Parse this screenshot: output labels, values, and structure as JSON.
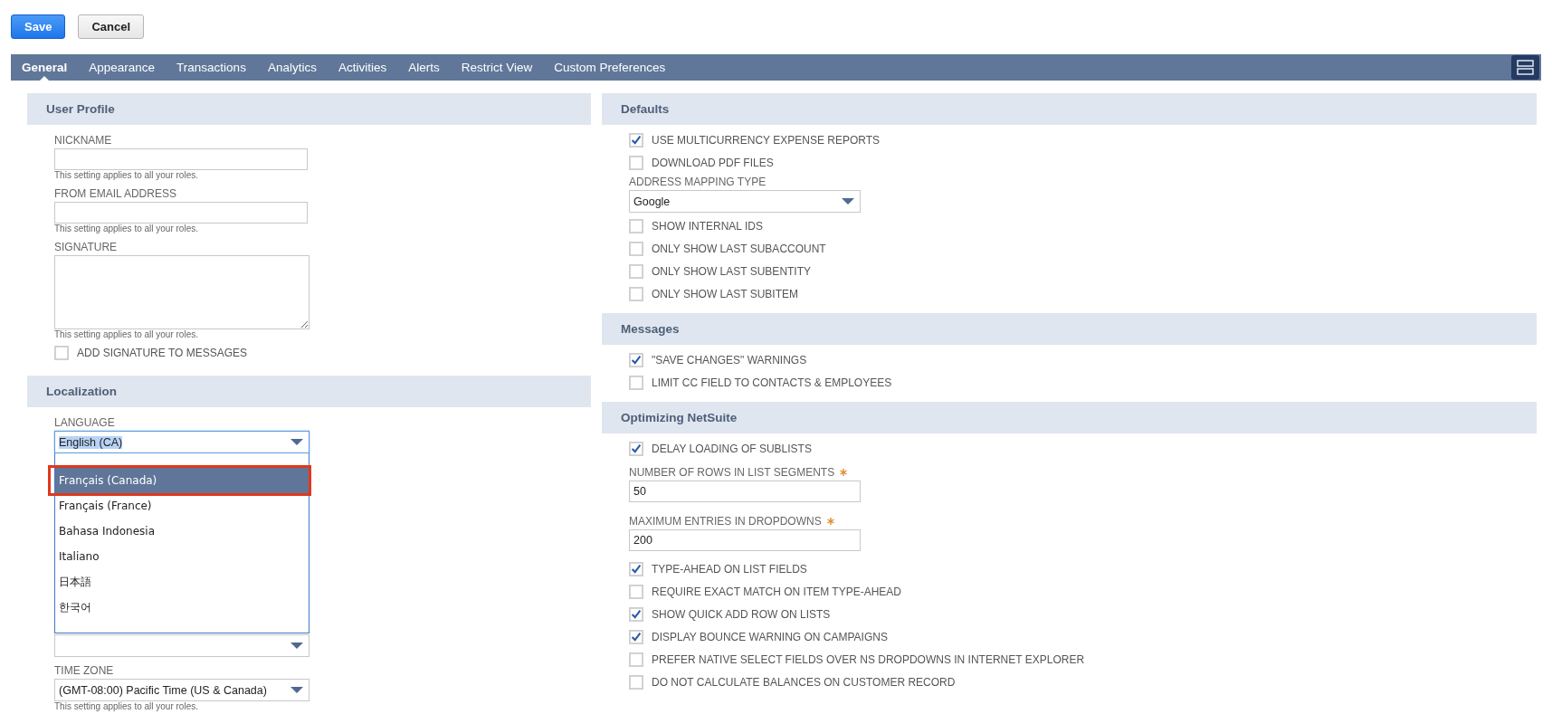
{
  "buttons": [
    {
      "label": "Save",
      "kind": "primary"
    },
    {
      "label": "Cancel",
      "kind": "secondary"
    }
  ],
  "tabs": [
    {
      "label": "General",
      "selected": true
    },
    {
      "label": "Appearance",
      "selected": false
    },
    {
      "label": "Transactions",
      "selected": false
    },
    {
      "label": "Analytics",
      "selected": false
    },
    {
      "label": "Activities",
      "selected": false
    },
    {
      "label": "Alerts",
      "selected": false
    },
    {
      "label": "Restrict View",
      "selected": false
    },
    {
      "label": "Custom Preferences",
      "selected": false
    }
  ],
  "columns": [
    {
      "sections": [
        {
          "title": "User Profile",
          "fields": [
            {
              "kind": "text",
              "label": "NICKNAME",
              "help": "This setting applies to all your roles."
            },
            {
              "kind": "text",
              "label": "FROM EMAIL ADDRESS",
              "help": "This setting applies to all your roles."
            },
            {
              "kind": "textarea",
              "label": "SIGNATURE",
              "help": "This setting applies to all your roles."
            },
            {
              "kind": "checkbox",
              "label": "ADD SIGNATURE TO MESSAGES",
              "checked": false
            }
          ]
        },
        {
          "title": "Localization",
          "fields": [
            {
              "kind": "select",
              "label": "LANGUAGE",
              "value": "English (CA)",
              "focused": true,
              "open_options": [
                {
                  "label": "Français (Canada)",
                  "selected": true,
                  "callout": true
                },
                {
                  "label": "Français (France)",
                  "selected": false,
                  "callout": false
                },
                {
                  "label": "Bahasa Indonesia",
                  "selected": false,
                  "callout": false
                },
                {
                  "label": "Italiano",
                  "selected": false,
                  "callout": false
                },
                {
                  "label": "日本語",
                  "selected": false,
                  "callout": false
                },
                {
                  "label": "한국어",
                  "selected": false,
                  "callout": false
                }
              ]
            },
            {
              "kind": "select",
              "focused": false
            },
            {
              "kind": "select",
              "label": "TIME ZONE",
              "value": "(GMT-08:00) Pacific Time (US & Canada)",
              "focused": false,
              "help": "This setting applies to all your roles."
            }
          ]
        }
      ]
    },
    {
      "sections": [
        {
          "title": "Defaults",
          "fields": [
            {
              "kind": "checkbox",
              "label": "USE MULTICURRENCY EXPENSE REPORTS",
              "checked": true
            },
            {
              "kind": "checkbox",
              "label": "DOWNLOAD PDF FILES",
              "checked": false
            },
            {
              "kind": "select",
              "label": "ADDRESS MAPPING TYPE",
              "value": "Google",
              "focused": false
            },
            {
              "kind": "checkbox",
              "label": "SHOW INTERNAL IDS",
              "checked": false
            },
            {
              "kind": "checkbox",
              "label": "ONLY SHOW LAST SUBACCOUNT",
              "checked": false
            },
            {
              "kind": "checkbox",
              "label": "ONLY SHOW LAST SUBENTITY",
              "checked": false
            },
            {
              "kind": "checkbox",
              "label": "ONLY SHOW LAST SUBITEM",
              "checked": false
            }
          ]
        },
        {
          "title": "Messages",
          "fields": [
            {
              "kind": "checkbox",
              "label": "\"SAVE CHANGES\" WARNINGS",
              "checked": true
            },
            {
              "kind": "checkbox",
              "label": "LIMIT CC FIELD TO CONTACTS & EMPLOYEES",
              "checked": false
            }
          ]
        },
        {
          "title": "Optimizing NetSuite",
          "fields": [
            {
              "kind": "checkbox",
              "label": "DELAY LOADING OF SUBLISTS",
              "checked": true
            },
            {
              "kind": "text",
              "label": "NUMBER OF ROWS IN LIST SEGMENTS",
              "required": true,
              "value": "50"
            },
            {
              "kind": "text",
              "label": "MAXIMUM ENTRIES IN DROPDOWNS",
              "required": true,
              "value": "200"
            },
            {
              "kind": "checkbox",
              "label": "TYPE-AHEAD ON LIST FIELDS",
              "checked": true
            },
            {
              "kind": "checkbox",
              "label": "REQUIRE EXACT MATCH ON ITEM TYPE-AHEAD",
              "checked": false
            },
            {
              "kind": "checkbox",
              "label": "SHOW QUICK ADD ROW ON LISTS",
              "checked": true
            },
            {
              "kind": "checkbox",
              "label": "DISPLAY BOUNCE WARNING ON CAMPAIGNS",
              "checked": true
            },
            {
              "kind": "checkbox",
              "label": "PREFER NATIVE SELECT FIELDS OVER NS DROPDOWNS IN INTERNET EXPLORER",
              "checked": false
            },
            {
              "kind": "checkbox",
              "label": "DO NOT CALCULATE BALANCES ON CUSTOMER RECORD",
              "checked": false
            }
          ]
        }
      ]
    }
  ]
}
